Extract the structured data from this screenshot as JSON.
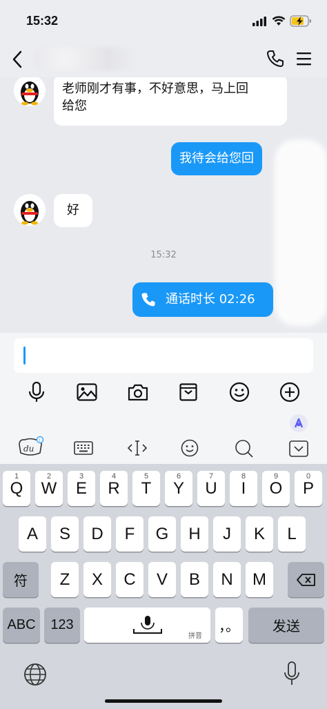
{
  "status_bar": {
    "time": "15:32"
  },
  "nav": {
    "back_icon": "chevron-left-icon",
    "call_icon": "phone-icon",
    "menu_icon": "menu-icon"
  },
  "messages": [
    {
      "side": "left",
      "text_line1": "老师刚才有事，不好意思，马上回",
      "text_line2": "给您"
    },
    {
      "side": "right",
      "text": "我待会给您回"
    },
    {
      "side": "left",
      "text": "好"
    },
    {
      "type": "timestamp",
      "text": "15:32"
    },
    {
      "side": "right",
      "type": "call",
      "text": "通话时长 02:26"
    }
  ],
  "input": {
    "value": ""
  },
  "toolbar": [
    "mic-icon",
    "image-icon",
    "camera-icon",
    "inbox-icon",
    "emoji-icon",
    "plus-icon"
  ],
  "ime_bar": [
    "du-logo-icon",
    "keyboard-icon",
    "cursor-icon",
    "emoji-icon",
    "search-icon",
    "collapse-icon"
  ],
  "keyboard": {
    "row1": [
      {
        "num": "1",
        "key": "Q"
      },
      {
        "num": "2",
        "key": "W"
      },
      {
        "num": "3",
        "key": "E"
      },
      {
        "num": "4",
        "key": "R"
      },
      {
        "num": "5",
        "key": "T"
      },
      {
        "num": "6",
        "key": "Y"
      },
      {
        "num": "7",
        "key": "U"
      },
      {
        "num": "8",
        "key": "I"
      },
      {
        "num": "9",
        "key": "O"
      },
      {
        "num": "0",
        "key": "P"
      }
    ],
    "row2": [
      "A",
      "S",
      "D",
      "F",
      "G",
      "H",
      "J",
      "K",
      "L"
    ],
    "row3": [
      "Z",
      "X",
      "C",
      "V",
      "B",
      "N",
      "M"
    ],
    "symbol_key": "符",
    "abc_key": "ABC",
    "num_key": "123",
    "space_hint": "拼音",
    "punct_key": "，。",
    "send_key": "发送"
  },
  "colors": {
    "accent": "#1a98f8"
  }
}
